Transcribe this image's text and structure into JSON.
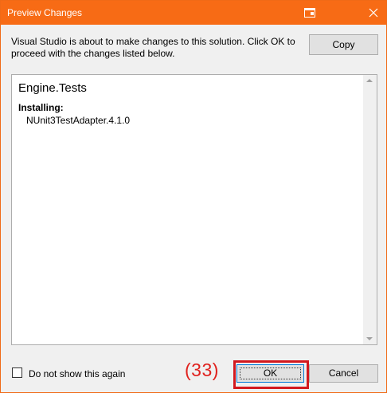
{
  "window": {
    "title": "Preview Changes",
    "title_icon": "restore-icon",
    "close_icon": "close-icon"
  },
  "message": "Visual Studio is about to make changes to this solution. Click OK to proceed with the changes listed below.",
  "buttons": {
    "copy_label": "Copy",
    "ok_label": "OK",
    "cancel_label": "Cancel"
  },
  "changes": {
    "project_name": "Engine.Tests",
    "section_label": "Installing:",
    "packages": [
      "NUnit3TestAdapter.4.1.0"
    ]
  },
  "checkbox": {
    "label": "Do not show this again",
    "checked": false
  },
  "annotation": {
    "step_label": "(33)",
    "highlight_color": "#d2181e"
  },
  "colors": {
    "titlebar": "#f76b15",
    "ok_border": "#0078d7"
  }
}
